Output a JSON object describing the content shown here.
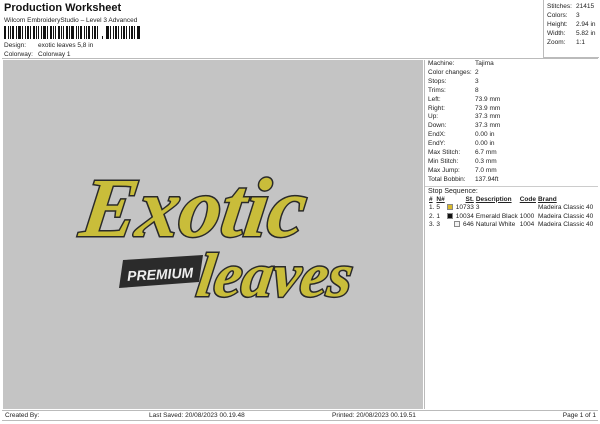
{
  "header": {
    "title": "Production Worksheet",
    "subtitle": "Wilcom EmbroideryStudio – Level 3 Advanced",
    "design_label": "Design:",
    "design_value": "exotic leaves 5,8 in",
    "colorway_label": "Colorway:",
    "colorway_value": "Colorway 1"
  },
  "summary": [
    {
      "k": "Stitches:",
      "v": "21415"
    },
    {
      "k": "Colors:",
      "v": "3"
    },
    {
      "k": "Height:",
      "v": "2.94 in"
    },
    {
      "k": "Width:",
      "v": "5.82 in"
    },
    {
      "k": "Zoom:",
      "v": "1:1"
    }
  ],
  "details": [
    {
      "k": "Machine:",
      "v": "Tajima"
    },
    {
      "k": "Color changes:",
      "v": "2"
    },
    {
      "k": "Stops:",
      "v": "3"
    },
    {
      "k": "Trims:",
      "v": "8"
    },
    {
      "k": "Left:",
      "v": "73.9 mm"
    },
    {
      "k": "Right:",
      "v": "73.9 mm"
    },
    {
      "k": "Up:",
      "v": "37.3 mm"
    },
    {
      "k": "Down:",
      "v": "37.3 mm"
    },
    {
      "k": "EndX:",
      "v": "0.00 in"
    },
    {
      "k": "EndY:",
      "v": "0.00 in"
    },
    {
      "k": "Max Stitch:",
      "v": "6.7 mm"
    },
    {
      "k": "Min Stitch:",
      "v": "0.3 mm"
    },
    {
      "k": "Max Jump:",
      "v": "7.0 mm"
    },
    {
      "k": "Total Bobbin:",
      "v": "137.94ft"
    }
  ],
  "stop_sequence": {
    "title": "Stop Sequence:",
    "columns": [
      "#",
      "N#",
      "St.",
      "Description",
      "Code",
      "Brand"
    ],
    "rows": [
      {
        "n": "1.",
        "nn": "5",
        "color": "#d9b92a",
        "st": "10733",
        "desc": "3",
        "code": "",
        "brand": "Madeira Classic 40"
      },
      {
        "n": "2.",
        "nn": "1",
        "color": "#111111",
        "st": "10034",
        "desc": "Emerald Black",
        "code": "1000",
        "brand": "Madeira Classic 40"
      },
      {
        "n": "3.",
        "nn": "3",
        "color": "#f2f2f2",
        "st": "646",
        "desc": "Natural White",
        "code": "1004",
        "brand": "Madeira Classic 40"
      }
    ]
  },
  "logo": {
    "word1": "Exotic",
    "word2": "leaves",
    "badge": "PREMIUM",
    "fill": "#c9bd3a",
    "outline": "#2a2a2a"
  },
  "footer": {
    "created": "Created By:",
    "saved": "Last Saved: 20/08/2023 00.19.48",
    "printed": "Printed: 20/08/2023 00.19.51",
    "page": "Page 1 of 1"
  }
}
